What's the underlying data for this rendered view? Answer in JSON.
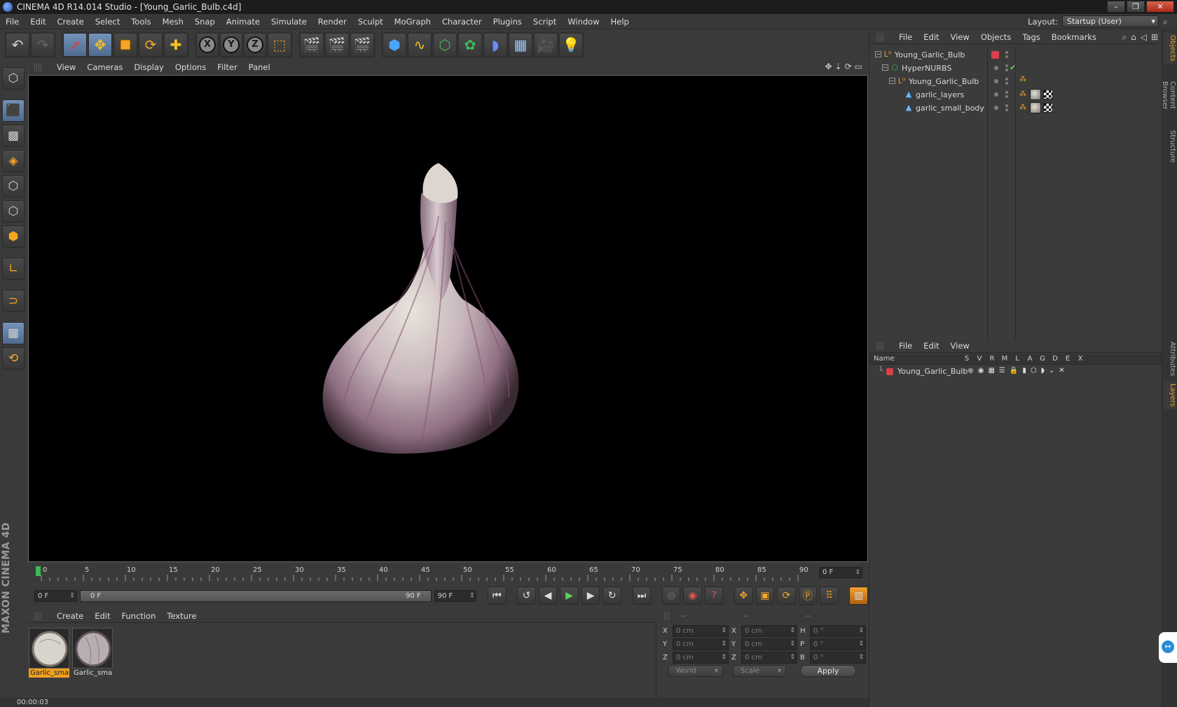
{
  "window": {
    "title": "CINEMA 4D R14.014 Studio - [Young_Garlic_Bulb.c4d]",
    "buttons": [
      "–",
      "❐",
      "✕"
    ]
  },
  "menu": [
    "File",
    "Edit",
    "Create",
    "Select",
    "Tools",
    "Mesh",
    "Snap",
    "Animate",
    "Simulate",
    "Render",
    "Sculpt",
    "MoGraph",
    "Character",
    "Plugins",
    "Script",
    "Window",
    "Help"
  ],
  "layout": {
    "label": "Layout:",
    "value": "Startup (User)"
  },
  "toolbar": {
    "undo": "undo-icon",
    "redo": "redo-icon",
    "tools": [
      "live-selection-icon",
      "move-icon",
      "scale-icon",
      "rotate-icon",
      "add-object-icon"
    ],
    "axes": [
      "X",
      "Y",
      "Z"
    ],
    "coord_system": "world-coordinates-icon",
    "render": [
      "render-view-icon",
      "render-picture-viewer-icon",
      "edit-render-settings-icon"
    ],
    "objects": [
      "cube-icon",
      "spline-pen-icon",
      "nurbs-icon",
      "array-icon",
      "deformer-icon",
      "floor-icon",
      "camera-icon",
      "light-icon"
    ]
  },
  "viewport": {
    "menu": [
      "View",
      "Cameras",
      "Display",
      "Options",
      "Filter",
      "Panel"
    ]
  },
  "timeline": {
    "ticks": [
      "0",
      "5",
      "10",
      "15",
      "20",
      "25",
      "30",
      "35",
      "40",
      "45",
      "50",
      "55",
      "60",
      "65",
      "70",
      "75",
      "80",
      "85",
      "90"
    ],
    "current_frame": "0 F"
  },
  "playback": {
    "start": "0 F",
    "range_start": "0 F",
    "range_end": "90 F",
    "end": "90 F"
  },
  "materials": {
    "menu": [
      "Create",
      "Edit",
      "Function",
      "Texture"
    ],
    "items": [
      {
        "label": "Garlic_smal",
        "selected": true
      },
      {
        "label": "Garlic_smal",
        "selected": false
      }
    ]
  },
  "coordinates": {
    "headers": [
      "--",
      "--",
      "--"
    ],
    "rows": [
      {
        "a": "X",
        "av": "0 cm",
        "b": "X",
        "bv": "0 cm",
        "c": "H",
        "cv": "0 °"
      },
      {
        "a": "Y",
        "av": "0 cm",
        "b": "Y",
        "bv": "0 cm",
        "c": "P",
        "cv": "0 °"
      },
      {
        "a": "Z",
        "av": "0 cm",
        "b": "Z",
        "bv": "0 cm",
        "c": "B",
        "cv": "0 °"
      }
    ],
    "space": "World",
    "mode": "Scale",
    "apply": "Apply"
  },
  "status": {
    "time": "00:00:03"
  },
  "objects_panel": {
    "menu": [
      "File",
      "Edit",
      "View",
      "Objects",
      "Tags",
      "Bookmarks"
    ],
    "tree": [
      {
        "name": "Young_Garlic_Bulb",
        "depth": 0,
        "icon": "null-object-icon"
      },
      {
        "name": "HyperNURBS",
        "depth": 1,
        "icon": "hypernurbs-icon"
      },
      {
        "name": "Young_Garlic_Bulb",
        "depth": 2,
        "icon": "null-object-icon"
      },
      {
        "name": "garlic_layers",
        "depth": 3,
        "icon": "polygon-object-icon"
      },
      {
        "name": "garlic_small_body",
        "depth": 3,
        "icon": "polygon-object-icon"
      }
    ]
  },
  "layers_panel": {
    "menu": [
      "File",
      "Edit",
      "View"
    ],
    "columns": [
      "Name",
      "S",
      "V",
      "R",
      "M",
      "L",
      "A",
      "G",
      "D",
      "E",
      "X"
    ],
    "row": "Young_Garlic_Bulb"
  },
  "side_tabs": [
    "Objects",
    "Content Browser",
    "Structure",
    "Attributes",
    "Layers"
  ],
  "brand": "MAXON CINEMA 4D",
  "colors": {
    "accent": "#f0a020",
    "active_tool": "#5f7ea6",
    "layer": "#d9404e"
  }
}
